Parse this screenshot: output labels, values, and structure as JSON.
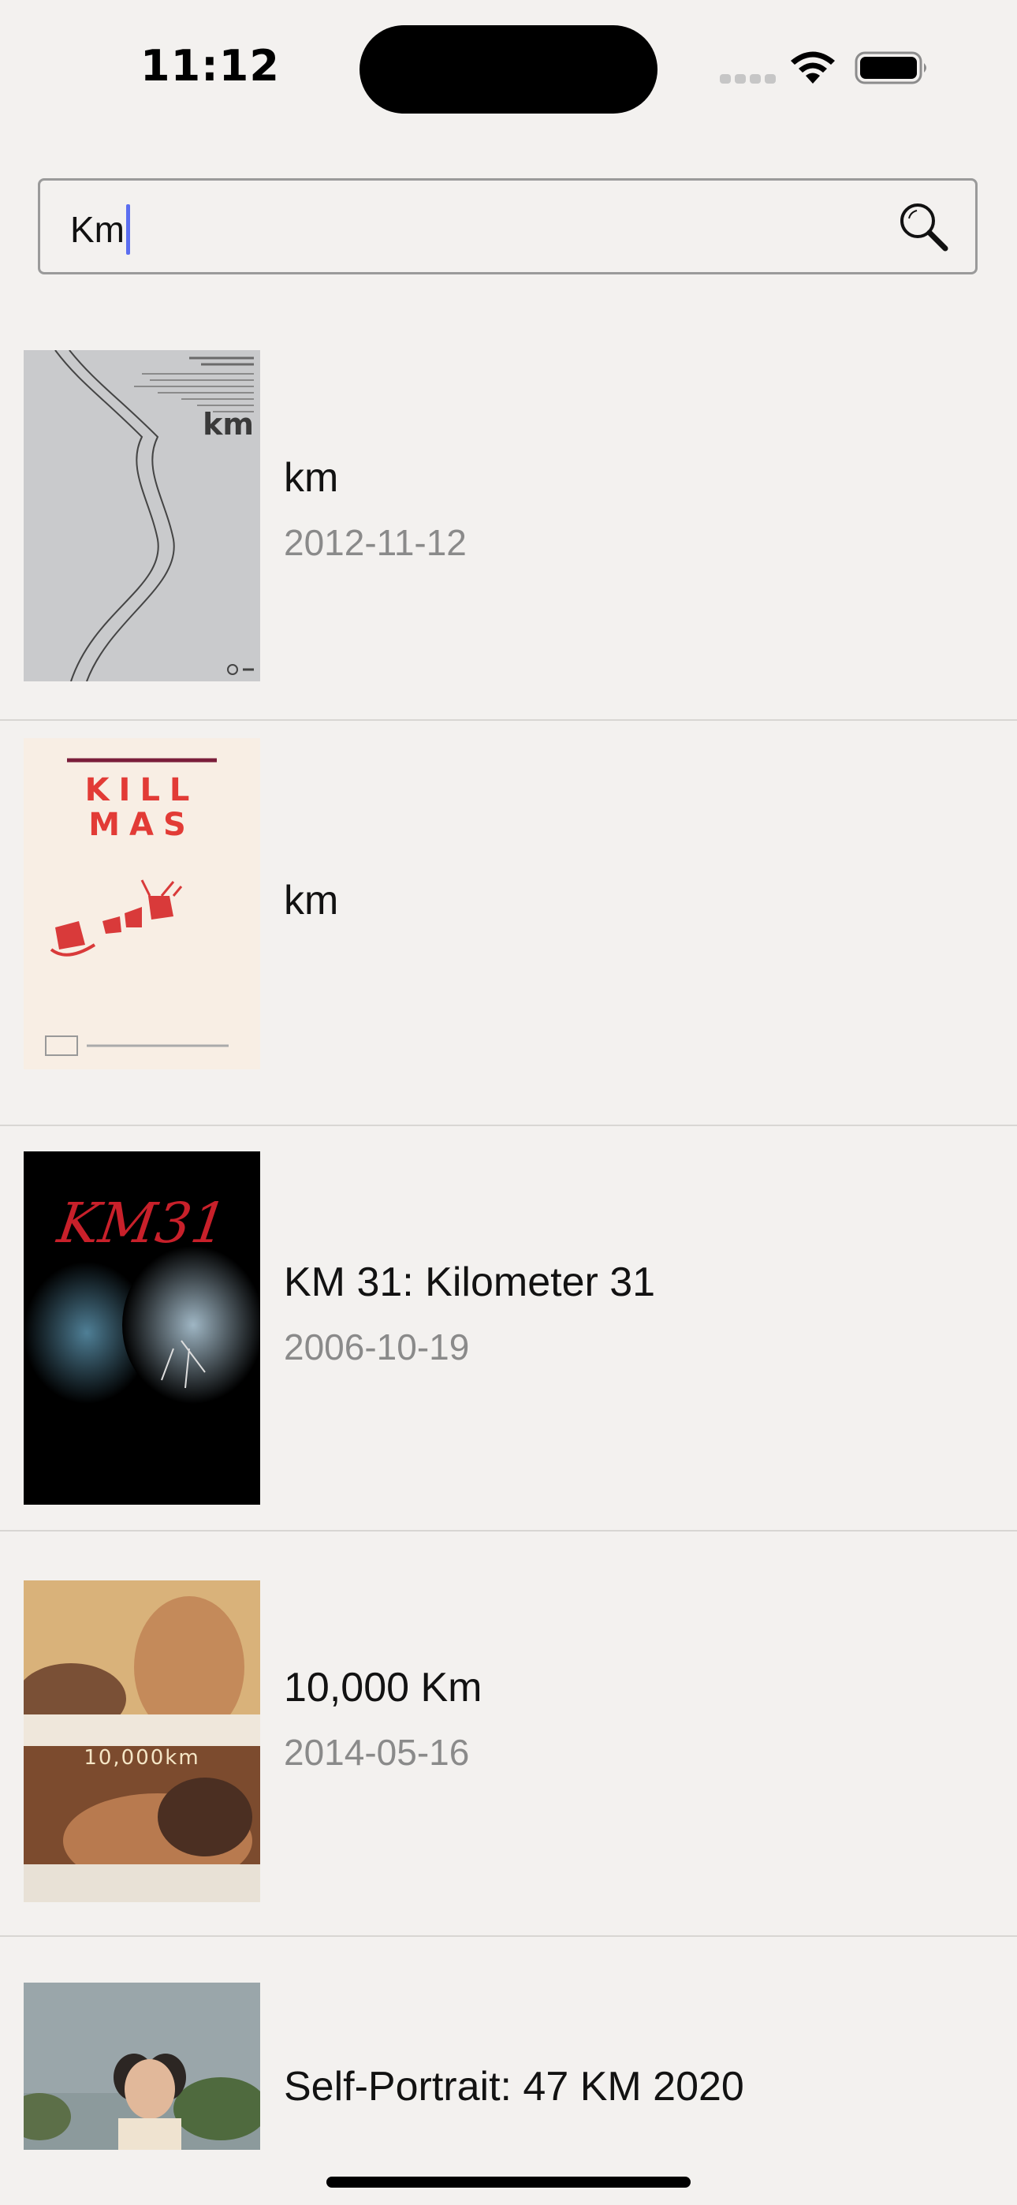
{
  "status_bar": {
    "time": "11:12"
  },
  "search": {
    "value": "Km",
    "icon": "search-icon"
  },
  "results": [
    {
      "title": "km",
      "date": "2012-11-12",
      "poster_caption": "km"
    },
    {
      "title": "km",
      "date": "",
      "poster_caption": "KILL MAS"
    },
    {
      "title": "KM 31: Kilometer 31",
      "date": "2006-10-19",
      "poster_caption": "KM31"
    },
    {
      "title": "10,000 Km",
      "date": "2014-05-16",
      "poster_caption": "10,000km"
    },
    {
      "title": "Self-Portrait: 47 KM 2020",
      "date": "",
      "poster_caption": ""
    }
  ]
}
